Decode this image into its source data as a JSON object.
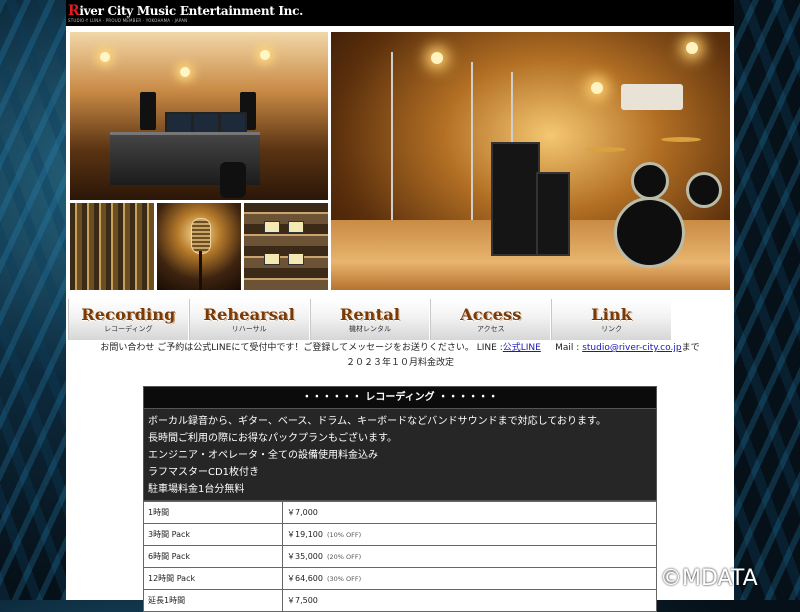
{
  "site": {
    "logo_prefix": "R",
    "logo_text": "iver City Music Entertainment Inc.",
    "logo_tagline": "STUDIO-Y LUNA · PROUD MEMBER · YOKOHAMA · JAPAN"
  },
  "nav": [
    {
      "en": "Recording",
      "jp": "レコーディング"
    },
    {
      "en": "Rehearsal",
      "jp": "リハーサル"
    },
    {
      "en": "Rental",
      "jp": "機材レンタル"
    },
    {
      "en": "Access",
      "jp": "アクセス"
    },
    {
      "en": "Link",
      "jp": "リンク"
    }
  ],
  "notice": {
    "text_before": "お問い合わせ ご予約は公式LINEにて受付中です！ご登録してメッセージをお送りください。 LINE :",
    "line_link": "公式LINE",
    "mail_label": "Mail :",
    "mail_link": "studio@river-city.co.jp",
    "text_after": "まで",
    "revision": "２０２３年１０月料金改定"
  },
  "recording": {
    "title": "・・・・・・ レコーディング ・・・・・・",
    "desc": [
      "ボーカル録音から、ギター、ベース、ドラム、キーボードなどバンドサウンドまで対応しております。",
      "長時間ご利用の際にお得なパックプランもございます。",
      "エンジニア・オペレータ・全ての設備使用料金込み",
      "ラフマスターCD1枚付き",
      "駐車場料金1台分無料"
    ],
    "rows": [
      {
        "name": "1時間",
        "price": "￥7,000",
        "off": ""
      },
      {
        "name": "3時間 Pack",
        "price": "￥19,100",
        "off": "(10% OFF)"
      },
      {
        "name": "6時間 Pack",
        "price": "￥35,000",
        "off": "(20% OFF)"
      },
      {
        "name": "12時間 Pack",
        "price": "￥64,600",
        "off": "(30% OFF)"
      },
      {
        "name": "延長1時間",
        "price": "￥7,500",
        "off": ""
      }
    ]
  },
  "watermark": "©MDATA"
}
